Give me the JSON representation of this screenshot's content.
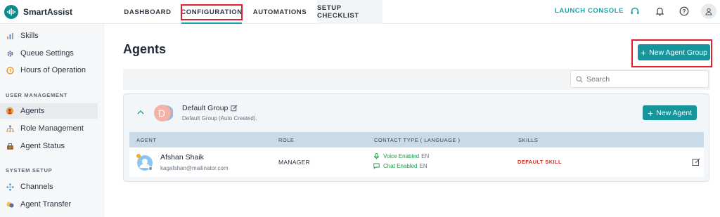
{
  "app": {
    "name": "SmartAssist"
  },
  "nav": {
    "tabs": [
      {
        "label": "DASHBOARD"
      },
      {
        "label": "CONFIGURATION"
      },
      {
        "label": "AUTOMATIONS"
      },
      {
        "label": "SETUP CHECKLIST"
      }
    ],
    "launch_label": "LAUNCH CONSOLE"
  },
  "sidebar": {
    "items_top": [
      {
        "label": "Skills",
        "icon": "skills-icon"
      },
      {
        "label": "Queue Settings",
        "icon": "queue-icon"
      },
      {
        "label": "Hours of Operation",
        "icon": "clock-icon"
      }
    ],
    "section_user": "USER MANAGEMENT",
    "items_user": [
      {
        "label": "Agents",
        "icon": "agents-icon"
      },
      {
        "label": "Role Management",
        "icon": "role-icon"
      },
      {
        "label": "Agent Status",
        "icon": "status-icon"
      }
    ],
    "section_system": "SYSTEM SETUP",
    "items_system": [
      {
        "label": "Channels",
        "icon": "channels-icon"
      },
      {
        "label": "Agent Transfer",
        "icon": "transfer-icon"
      }
    ]
  },
  "page": {
    "title": "Agents",
    "new_group_label": "New Agent Group",
    "search_placeholder": "Search"
  },
  "group": {
    "initial": "D",
    "name": "Default Group",
    "description": "Default Group (Auto Created).",
    "new_agent_label": "New Agent",
    "columns": [
      "AGENT",
      "ROLE",
      "CONTACT TYPE ( LANGUAGE )",
      "SKILLS"
    ],
    "agents": [
      {
        "name": "Afshan Shaik",
        "email": "kagafshan@mailinator.com",
        "role": "MANAGER",
        "voice": "Voice Enabled",
        "chat": "Chat Enabled",
        "voice_lang": "EN",
        "chat_lang": "EN",
        "skill": "DEFAULT SKILL"
      }
    ]
  },
  "colors": {
    "accent": "#16959c",
    "highlight": "#e0202a",
    "skill": "#d0312d"
  }
}
